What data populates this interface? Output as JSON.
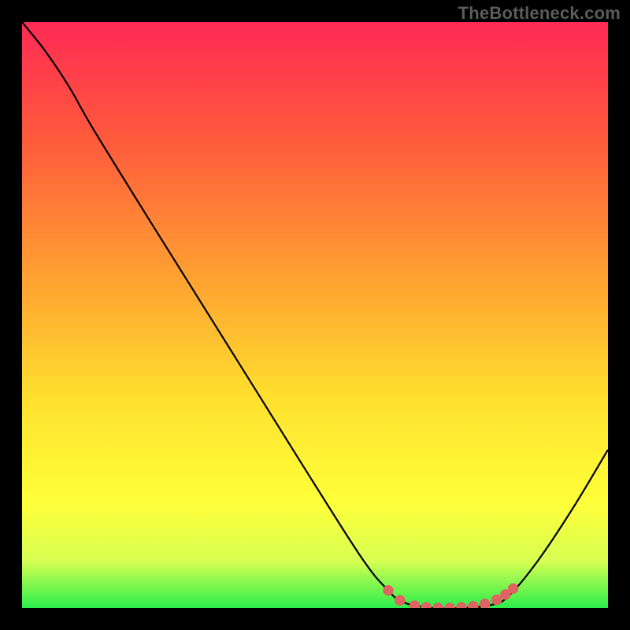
{
  "watermark": "TheBottleneck.com",
  "chart_data": {
    "type": "line",
    "title": "",
    "xlabel": "",
    "ylabel": "",
    "xlim": [
      0,
      100
    ],
    "ylim": [
      0,
      100
    ],
    "gradient_stops": [
      {
        "offset": 0,
        "color": "#ff2a55"
      },
      {
        "offset": 20,
        "color": "#ff5a3c"
      },
      {
        "offset": 45,
        "color": "#ffa531"
      },
      {
        "offset": 65,
        "color": "#ffe22e"
      },
      {
        "offset": 82,
        "color": "#ffff3a"
      },
      {
        "offset": 92,
        "color": "#d7ff52"
      },
      {
        "offset": 100,
        "color": "#2bed4b"
      }
    ],
    "series": [
      {
        "name": "curve",
        "stroke": "#000000",
        "points": [
          {
            "x": 0.0,
            "y": 100.0
          },
          {
            "x": 4.0,
            "y": 95.0
          },
          {
            "x": 8.0,
            "y": 89.0
          },
          {
            "x": 12.0,
            "y": 82.0
          },
          {
            "x": 20.0,
            "y": 69.0
          },
          {
            "x": 30.0,
            "y": 53.0
          },
          {
            "x": 40.0,
            "y": 37.0
          },
          {
            "x": 50.0,
            "y": 21.0
          },
          {
            "x": 58.0,
            "y": 8.5
          },
          {
            "x": 62.0,
            "y": 3.5
          },
          {
            "x": 65.0,
            "y": 1.0
          },
          {
            "x": 70.0,
            "y": 0.0
          },
          {
            "x": 75.0,
            "y": 0.0
          },
          {
            "x": 80.0,
            "y": 0.5
          },
          {
            "x": 83.0,
            "y": 2.0
          },
          {
            "x": 88.0,
            "y": 8.0
          },
          {
            "x": 94.0,
            "y": 17.0
          },
          {
            "x": 100.0,
            "y": 27.0
          }
        ]
      }
    ],
    "markers": {
      "color": "#e06262",
      "radius_pct": 0.9,
      "points": [
        {
          "x": 62.5,
          "y": 3.0
        },
        {
          "x": 64.5,
          "y": 1.3
        },
        {
          "x": 67.0,
          "y": 0.4
        },
        {
          "x": 69.0,
          "y": 0.1
        },
        {
          "x": 71.0,
          "y": 0.0
        },
        {
          "x": 73.0,
          "y": 0.0
        },
        {
          "x": 75.0,
          "y": 0.1
        },
        {
          "x": 77.0,
          "y": 0.3
        },
        {
          "x": 79.0,
          "y": 0.7
        },
        {
          "x": 81.0,
          "y": 1.4
        },
        {
          "x": 82.5,
          "y": 2.3
        },
        {
          "x": 83.8,
          "y": 3.3
        }
      ]
    }
  }
}
